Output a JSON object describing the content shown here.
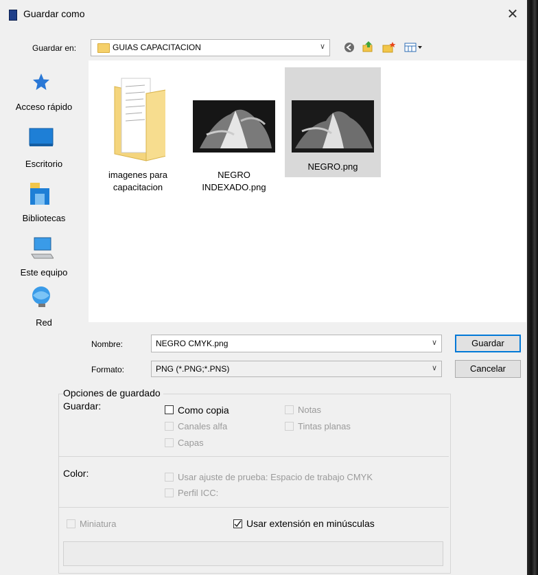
{
  "window": {
    "title": "Guardar como",
    "close_glyph": "✕"
  },
  "location": {
    "label": "Guardar en:",
    "value": "GUIAS CAPACITACION",
    "arrow": "∨"
  },
  "sidebar": {
    "items": [
      {
        "label": "Acceso rápido",
        "icon": "star-icon"
      },
      {
        "label": "Escritorio",
        "icon": "desktop-icon"
      },
      {
        "label": "Bibliotecas",
        "icon": "library-icon"
      },
      {
        "label": "Este equipo",
        "icon": "computer-icon"
      },
      {
        "label": "Red",
        "icon": "network-icon"
      }
    ]
  },
  "files": [
    {
      "line1": "imagenes para",
      "line2": "capacitacion",
      "type": "folder",
      "selected": false
    },
    {
      "line1": "NEGRO",
      "line2": "INDEXADO.png",
      "type": "image",
      "selected": false
    },
    {
      "line1": "NEGRO.png",
      "line2": "",
      "type": "image",
      "selected": true
    }
  ],
  "form": {
    "name_label": "Nombre:",
    "name_value": "NEGRO CMYK.png",
    "format_label": "Formato:",
    "format_value": "PNG (*.PNG;*.PNS)",
    "arrow": "∨"
  },
  "buttons": {
    "save": "Guardar",
    "cancel": "Cancelar"
  },
  "options": {
    "legend": "Opciones de guardado",
    "save_label": "Guardar:",
    "as_copy": "Como copia",
    "notes": "Notas",
    "alpha": "Canales alfa",
    "spot": "Tintas planas",
    "layers": "Capas",
    "color_label": "Color:",
    "proof": "Usar ajuste de prueba: Espacio de trabajo CMYK",
    "icc": "Perfil ICC:",
    "thumbnail": "Miniatura",
    "lowercase": "Usar extensión en minúsculas"
  },
  "colors": {
    "accent": "#0078d7",
    "selection": "#d9d9d9",
    "folder": "#f5d06a"
  }
}
